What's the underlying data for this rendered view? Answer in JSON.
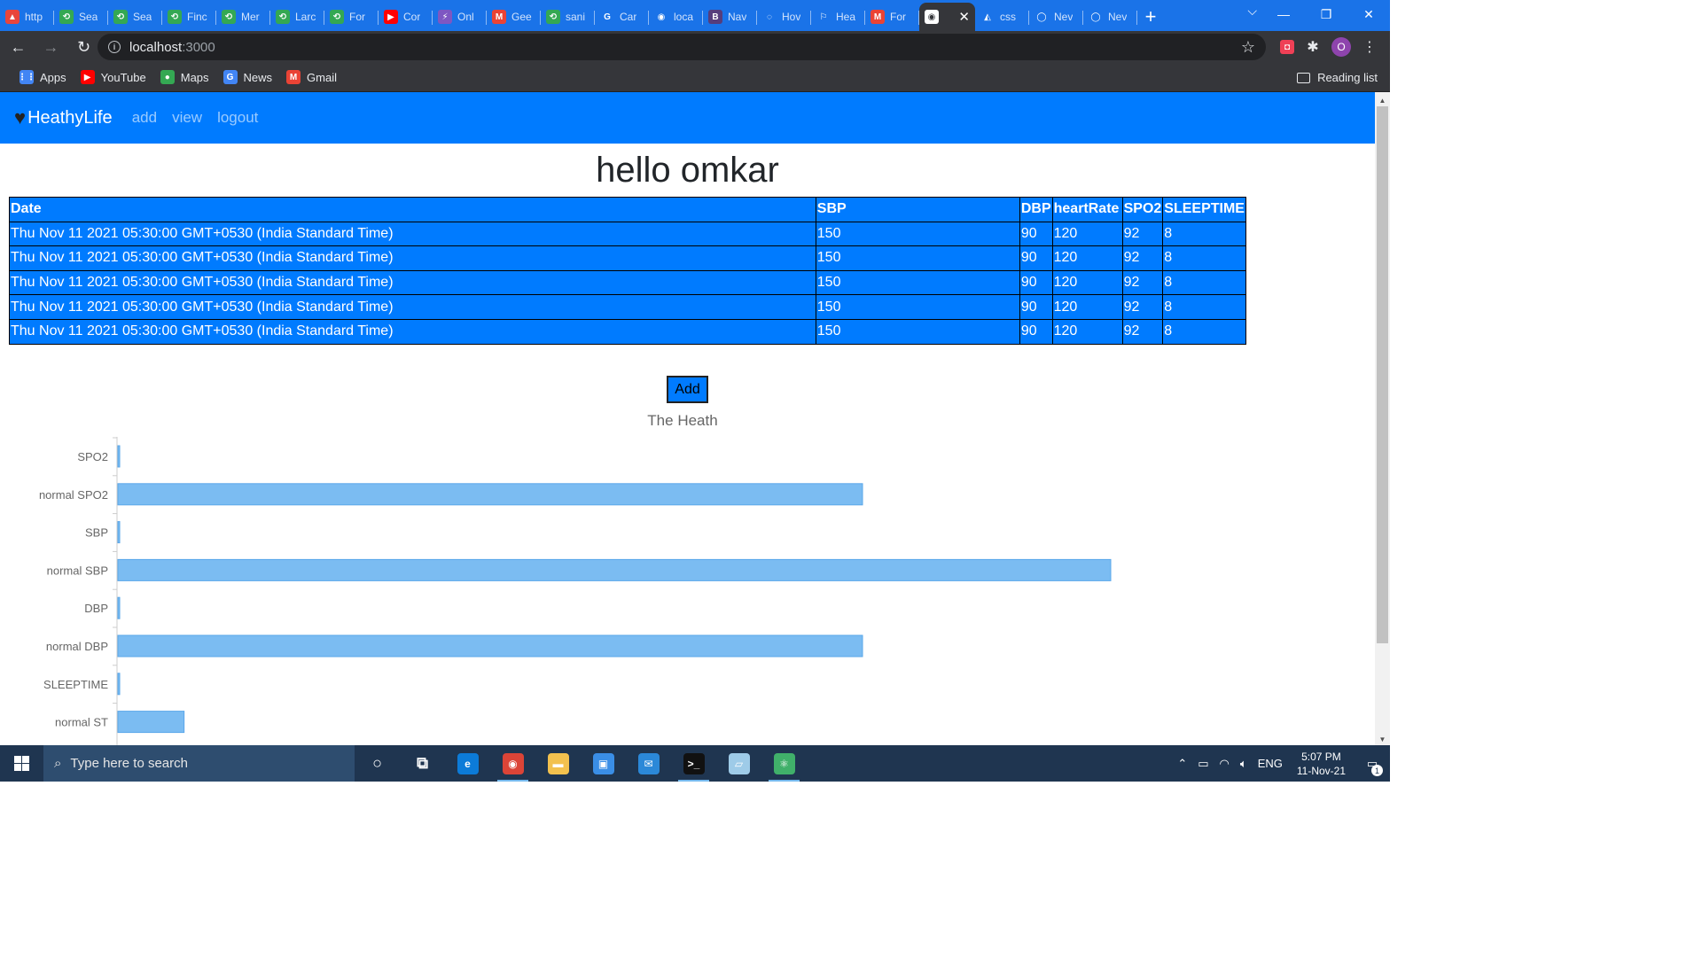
{
  "browser": {
    "tabs": [
      {
        "title": "http",
        "fav": "▲",
        "color": "#e8453c"
      },
      {
        "title": "Sea",
        "fav": "⟲",
        "color": "#34a853"
      },
      {
        "title": "Sea",
        "fav": "⟲",
        "color": "#34a853"
      },
      {
        "title": "Finc",
        "fav": "⟲",
        "color": "#34a853"
      },
      {
        "title": "Mer",
        "fav": "⟲",
        "color": "#34a853"
      },
      {
        "title": "Larc",
        "fav": "⟲",
        "color": "#34a853"
      },
      {
        "title": "For",
        "fav": "⟲",
        "color": "#34a853"
      },
      {
        "title": "Cor",
        "fav": "▶",
        "color": "#ff0000"
      },
      {
        "title": "Onl",
        "fav": "⚡",
        "color": "#7e57c2"
      },
      {
        "title": "Gee",
        "fav": "M",
        "color": "#ea4335"
      },
      {
        "title": "sani",
        "fav": "⟲",
        "color": "#34a853"
      },
      {
        "title": "Car",
        "fav": "G",
        "color": "#1a73e8"
      },
      {
        "title": "loca",
        "fav": "◉",
        "color": "#1a73e8"
      },
      {
        "title": "Nav",
        "fav": "B",
        "color": "#563d7c"
      },
      {
        "title": "Hov",
        "fav": "◌",
        "color": "#1a73e8"
      },
      {
        "title": "Hea",
        "fav": "⚐",
        "color": "#1a73e8"
      },
      {
        "title": "For",
        "fav": "M",
        "color": "#ea4335"
      },
      {
        "title": "",
        "fav": "◉",
        "color": "#35363a",
        "active": true
      },
      {
        "title": "css",
        "fav": "◭",
        "color": "#1a73e8"
      },
      {
        "title": "Nev",
        "fav": "◯",
        "color": "#1a73e8"
      },
      {
        "title": "Nev",
        "fav": "◯",
        "color": "#1a73e8"
      }
    ],
    "url_host": "localhost",
    "url_port": ":3000",
    "profile_initial": "O",
    "bookmarks": [
      {
        "label": "Apps",
        "icon": "apps-grid-icon",
        "glyph": "⋮⋮",
        "color": "#4285f4"
      },
      {
        "label": "YouTube",
        "icon": "youtube-icon",
        "glyph": "▶",
        "color": "#ff0000"
      },
      {
        "label": "Maps",
        "icon": "maps-icon",
        "glyph": "●",
        "color": "#34a853"
      },
      {
        "label": "News",
        "icon": "news-icon",
        "glyph": "G",
        "color": "#4285f4"
      },
      {
        "label": "Gmail",
        "icon": "gmail-icon",
        "glyph": "M",
        "color": "#ea4335"
      }
    ],
    "reading_list": "Reading list"
  },
  "navbar": {
    "brand": "HeathyLife",
    "links": [
      "add",
      "view",
      "logout"
    ]
  },
  "greeting": "hello omkar",
  "table": {
    "headers": [
      "Date",
      "SBP",
      "DBP",
      "heartRate",
      "SPO2",
      "SLEEPTIME"
    ],
    "rows": [
      [
        "Thu Nov 11 2021 05:30:00 GMT+0530 (India Standard Time)",
        "150",
        "90",
        "120",
        "92",
        "8"
      ],
      [
        "Thu Nov 11 2021 05:30:00 GMT+0530 (India Standard Time)",
        "150",
        "90",
        "120",
        "92",
        "8"
      ],
      [
        "Thu Nov 11 2021 05:30:00 GMT+0530 (India Standard Time)",
        "150",
        "90",
        "120",
        "92",
        "8"
      ],
      [
        "Thu Nov 11 2021 05:30:00 GMT+0530 (India Standard Time)",
        "150",
        "90",
        "120",
        "92",
        "8"
      ],
      [
        "Thu Nov 11 2021 05:30:00 GMT+0530 (India Standard Time)",
        "150",
        "90",
        "120",
        "92",
        "8"
      ]
    ]
  },
  "add_button": "Add",
  "chart_data": {
    "type": "bar",
    "orientation": "horizontal",
    "title": "The Heath",
    "categories": [
      "SPO2",
      "normal SPO2",
      "SBP",
      "normal SBP",
      "DBP",
      "normal DBP",
      "SLEEPTIME",
      "normal ST"
    ],
    "values": [
      0,
      90,
      0,
      120,
      0,
      90,
      0,
      8
    ],
    "bar_color": "#7bbcf2",
    "xlim": [
      0,
      150
    ]
  },
  "taskbar": {
    "search_placeholder": "Type here to search",
    "apps": [
      {
        "name": "cortana-icon",
        "glyph": "○",
        "color": "transparent"
      },
      {
        "name": "task-view-icon",
        "glyph": "⧉",
        "color": "transparent"
      },
      {
        "name": "edge-icon",
        "glyph": "e",
        "color": "#0c7bd8"
      },
      {
        "name": "chrome-icon",
        "glyph": "◉",
        "color": "#db4437",
        "running": true
      },
      {
        "name": "file-explorer-icon",
        "glyph": "▬",
        "color": "#f2c14e"
      },
      {
        "name": "store-icon",
        "glyph": "▣",
        "color": "#3a8ee6"
      },
      {
        "name": "mail-icon",
        "glyph": "✉",
        "color": "#2b88d8"
      },
      {
        "name": "terminal-icon",
        "glyph": ">_",
        "color": "#111111",
        "running": true
      },
      {
        "name": "notepad-icon",
        "glyph": "▱",
        "color": "#9ecbe8"
      },
      {
        "name": "atom-icon",
        "glyph": "⚛",
        "color": "#40b06a",
        "running": true
      }
    ],
    "lang": "ENG",
    "time": "5:07 PM",
    "date": "11-Nov-21",
    "notifications": "1"
  }
}
